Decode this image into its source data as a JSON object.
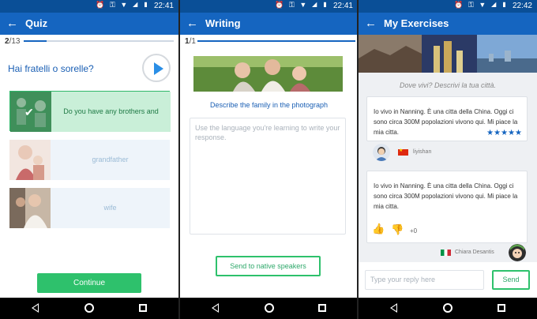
{
  "status": {
    "time_1": "22:41",
    "time_2": "22:41",
    "time_3": "22:42"
  },
  "quiz": {
    "title": "Quiz",
    "progress_current": "2",
    "progress_total": "/13",
    "progress_fraction": 0.154,
    "question": "Hai fratelli o sorelle?",
    "options": [
      {
        "label": "Do you have any brothers and sisters?",
        "state": "correct"
      },
      {
        "label": "grandfather",
        "state": "plain"
      },
      {
        "label": "wife",
        "state": "plain"
      }
    ],
    "continue_label": "Continue"
  },
  "writing": {
    "title": "Writing",
    "progress_current": "1",
    "progress_total": "/1",
    "progress_fraction": 1.0,
    "prompt": "Describe the family in the photograph",
    "placeholder": "Use the language you're learning to write your response.",
    "send_label": "Send to native speakers"
  },
  "exercises": {
    "title": "My Exercises",
    "question": "Dove vivi? Descrivi la tua città.",
    "answer_1": "Io vivo in Nanning. È una citta della China. Oggi ci sono circa 300M popolazioni vivono qui. Mi piace la mia citta.",
    "rating_stars": 5,
    "author_1": "liyishan",
    "answer_2": "Io vivo in Nanning. È una citta della China. Oggi ci sono circa 300M popolazioni vivono qui. Mi piace la mia citta.",
    "vote_count": "+0",
    "author_2": "Chiara Desantis",
    "reply_placeholder": "Type your reply here",
    "send_label": "Send"
  },
  "colors": {
    "primary": "#1565c0",
    "status_bar": "#0a4f97",
    "accent_green": "#2ec16c"
  },
  "icons": [
    "back-arrow-icon",
    "play-icon",
    "check-icon",
    "thumbs-up-icon",
    "thumbs-down-icon",
    "star-icon",
    "flag-china-icon",
    "flag-italy-icon",
    "nav-back-icon",
    "nav-home-icon",
    "nav-recent-icon"
  ]
}
